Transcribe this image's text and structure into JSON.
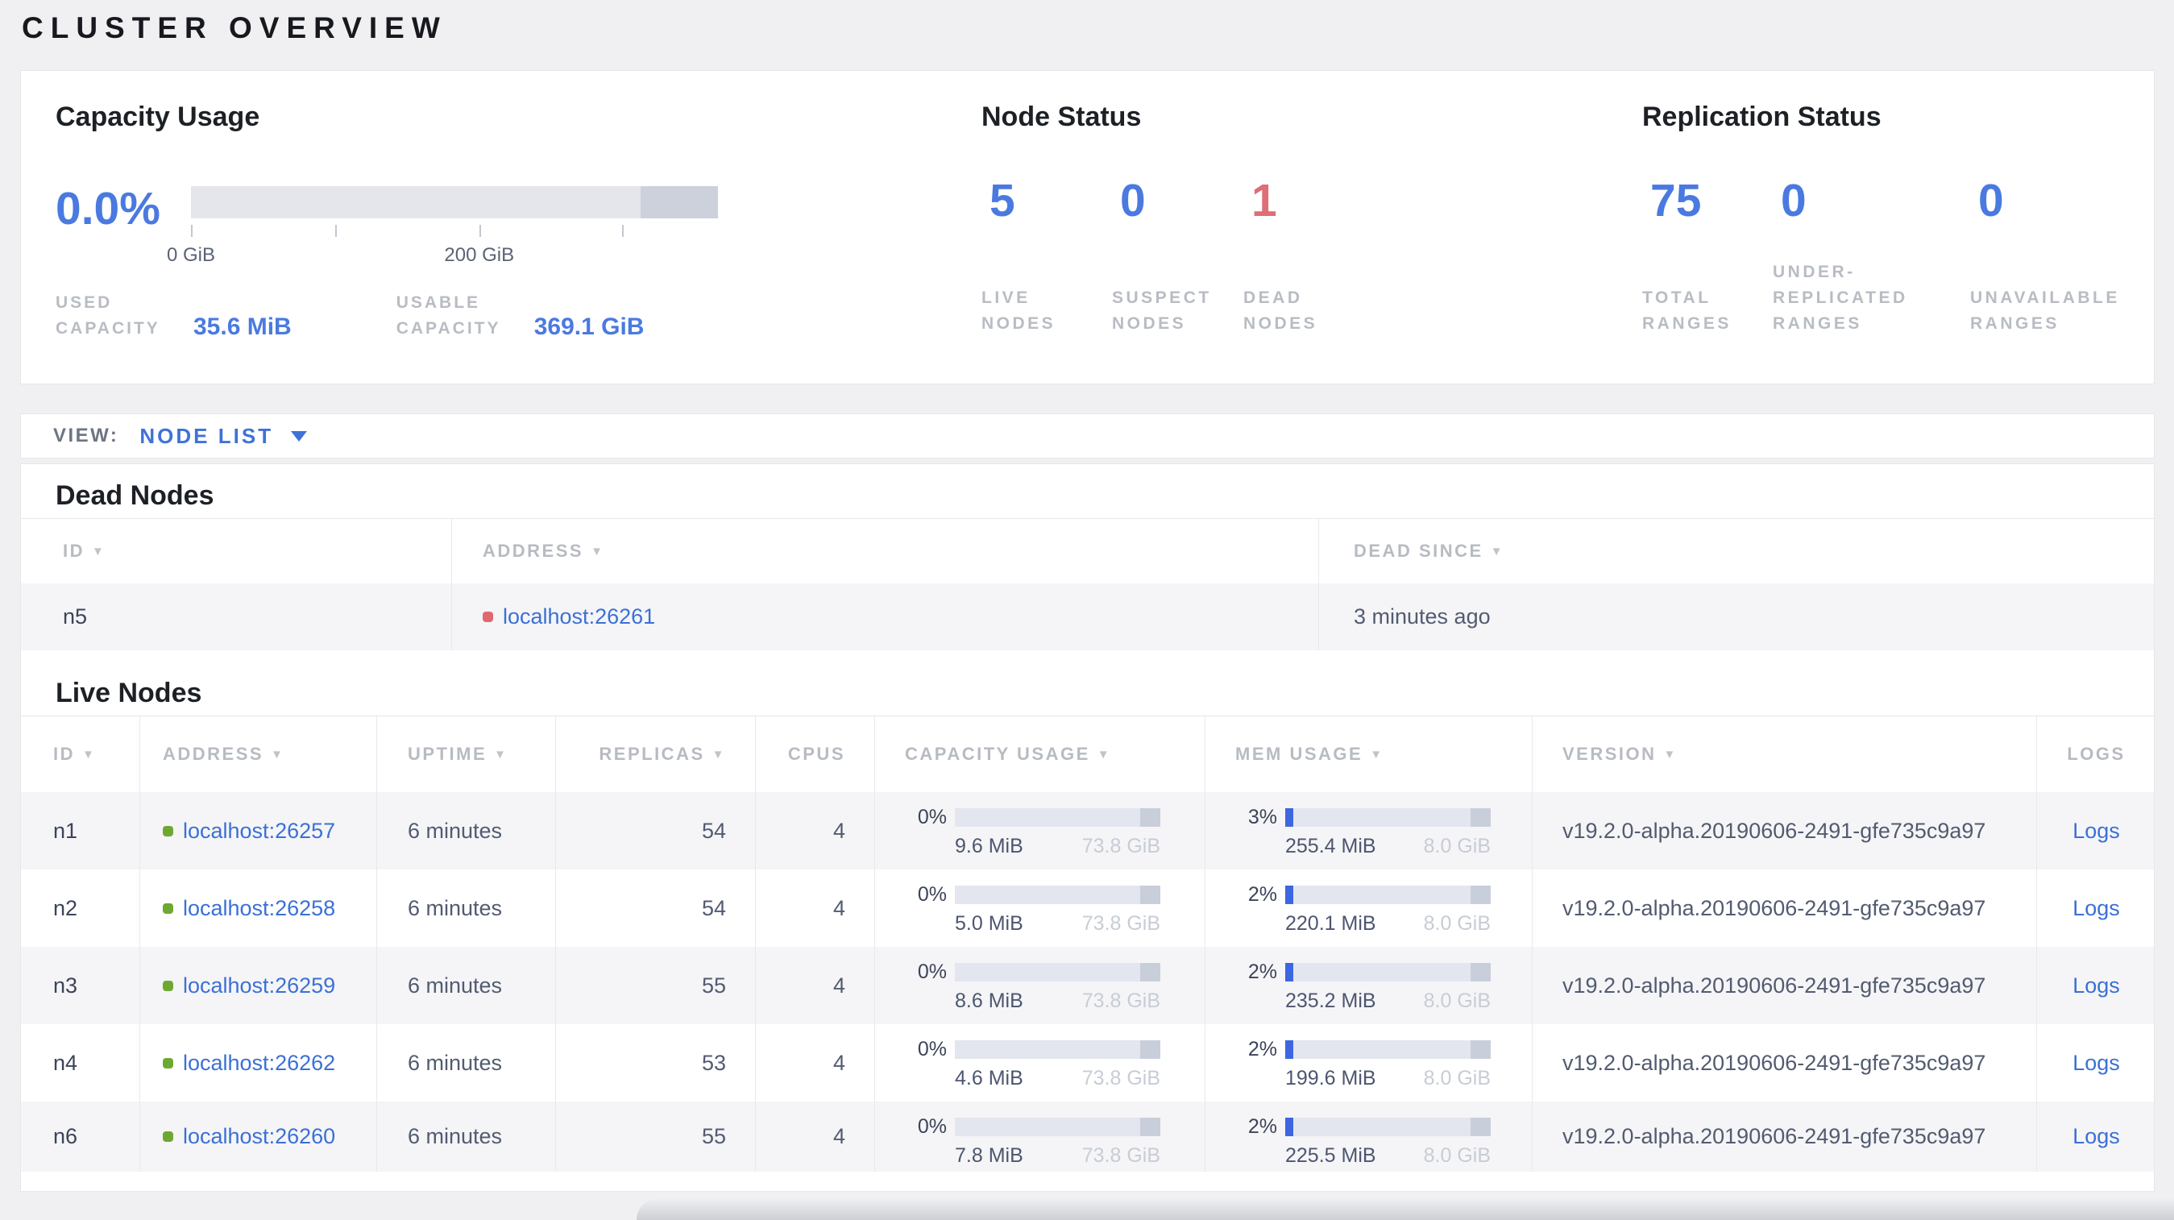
{
  "page": {
    "title": "CLUSTER OVERVIEW"
  },
  "colors": {
    "accent_blue": "#4a7ae0",
    "link_blue": "#3b70d6",
    "dead_red": "#df6e76",
    "live_green": "#6ea832",
    "label_gray": "#b8bcc3",
    "row_stripe": "#f5f5f7",
    "bar_track": "#e4e6ec",
    "bar_dark": "#ccd1db"
  },
  "summary": {
    "capacity": {
      "title": "Capacity Usage",
      "percent": "0.0%",
      "bar": {
        "dark_segment_start_frac": 0.853,
        "ticks": [
          {
            "frac": 0.0,
            "label": "0 GiB"
          },
          {
            "frac": 0.273,
            "label": ""
          },
          {
            "frac": 0.547,
            "label": "200 GiB"
          },
          {
            "frac": 0.818,
            "label": ""
          }
        ]
      },
      "stats": [
        {
          "lines": [
            "USED",
            "CAPACITY"
          ],
          "value": "35.6 MiB"
        },
        {
          "lines": [
            "USABLE",
            "CAPACITY"
          ],
          "value": "369.1 GiB"
        }
      ]
    },
    "node_status": {
      "title": "Node Status",
      "stats": [
        {
          "value": "5",
          "lines": [
            "LIVE",
            "NODES"
          ],
          "color": "blue"
        },
        {
          "value": "0",
          "lines": [
            "SUSPECT",
            "NODES"
          ],
          "color": "blue"
        },
        {
          "value": "1",
          "lines": [
            "DEAD",
            "NODES"
          ],
          "color": "red"
        }
      ]
    },
    "replication": {
      "title": "Replication Status",
      "stats": [
        {
          "value": "75",
          "lines": [
            "TOTAL",
            "RANGES"
          ]
        },
        {
          "value": "0",
          "lines": [
            "UNDER-",
            "REPLICATED",
            "RANGES"
          ]
        },
        {
          "value": "0",
          "lines": [
            "UNAVAILABLE",
            "RANGES"
          ]
        }
      ]
    }
  },
  "view_bar": {
    "label": "VIEW:",
    "selected": "NODE LIST"
  },
  "dead_nodes": {
    "title": "Dead Nodes",
    "columns": [
      {
        "label": "ID"
      },
      {
        "label": "ADDRESS"
      },
      {
        "label": "DEAD SINCE"
      }
    ],
    "rows": [
      {
        "id": "n5",
        "address": "localhost:26261",
        "dead_since": "3 minutes ago"
      }
    ]
  },
  "live_nodes": {
    "title": "Live Nodes",
    "columns": [
      {
        "label": "ID"
      },
      {
        "label": "ADDRESS"
      },
      {
        "label": "UPTIME"
      },
      {
        "label": "REPLICAS"
      },
      {
        "label": "CPUS"
      },
      {
        "label": "CAPACITY USAGE"
      },
      {
        "label": "MEM USAGE"
      },
      {
        "label": "VERSION"
      },
      {
        "label": "LOGS"
      }
    ],
    "logs_label": "Logs",
    "rows": [
      {
        "id": "n1",
        "address": "localhost:26257",
        "uptime": "6 minutes",
        "replicas": "54",
        "cpus": "4",
        "capacity": {
          "pct": "0%",
          "pct_num": 0,
          "used": "9.6 MiB",
          "total": "73.8 GiB"
        },
        "mem": {
          "pct": "3%",
          "pct_num": 3,
          "used": "255.4 MiB",
          "total": "8.0 GiB"
        },
        "version": "v19.2.0-alpha.20190606-2491-gfe735c9a97",
        "logs_label": "Logs"
      },
      {
        "id": "n2",
        "address": "localhost:26258",
        "uptime": "6 minutes",
        "replicas": "54",
        "cpus": "4",
        "capacity": {
          "pct": "0%",
          "pct_num": 0,
          "used": "5.0 MiB",
          "total": "73.8 GiB"
        },
        "mem": {
          "pct": "2%",
          "pct_num": 2,
          "used": "220.1 MiB",
          "total": "8.0 GiB"
        },
        "version": "v19.2.0-alpha.20190606-2491-gfe735c9a97",
        "logs_label": "Logs"
      },
      {
        "id": "n3",
        "address": "localhost:26259",
        "uptime": "6 minutes",
        "replicas": "55",
        "cpus": "4",
        "capacity": {
          "pct": "0%",
          "pct_num": 0,
          "used": "8.6 MiB",
          "total": "73.8 GiB"
        },
        "mem": {
          "pct": "2%",
          "pct_num": 2,
          "used": "235.2 MiB",
          "total": "8.0 GiB"
        },
        "version": "v19.2.0-alpha.20190606-2491-gfe735c9a97",
        "logs_label": "Logs"
      },
      {
        "id": "n4",
        "address": "localhost:26262",
        "uptime": "6 minutes",
        "replicas": "53",
        "cpus": "4",
        "capacity": {
          "pct": "0%",
          "pct_num": 0,
          "used": "4.6 MiB",
          "total": "73.8 GiB"
        },
        "mem": {
          "pct": "2%",
          "pct_num": 2,
          "used": "199.6 MiB",
          "total": "8.0 GiB"
        },
        "version": "v19.2.0-alpha.20190606-2491-gfe735c9a97",
        "logs_label": "Logs"
      },
      {
        "id": "n6",
        "address": "localhost:26260",
        "uptime": "6 minutes",
        "replicas": "55",
        "cpus": "4",
        "capacity": {
          "pct": "0%",
          "pct_num": 0,
          "used": "7.8 MiB",
          "total": "73.8 GiB"
        },
        "mem": {
          "pct": "2%",
          "pct_num": 2,
          "used": "225.5 MiB",
          "total": "8.0 GiB"
        },
        "version": "v19.2.0-alpha.20190606-2491-gfe735c9a97",
        "logs_label": "Logs"
      }
    ]
  }
}
